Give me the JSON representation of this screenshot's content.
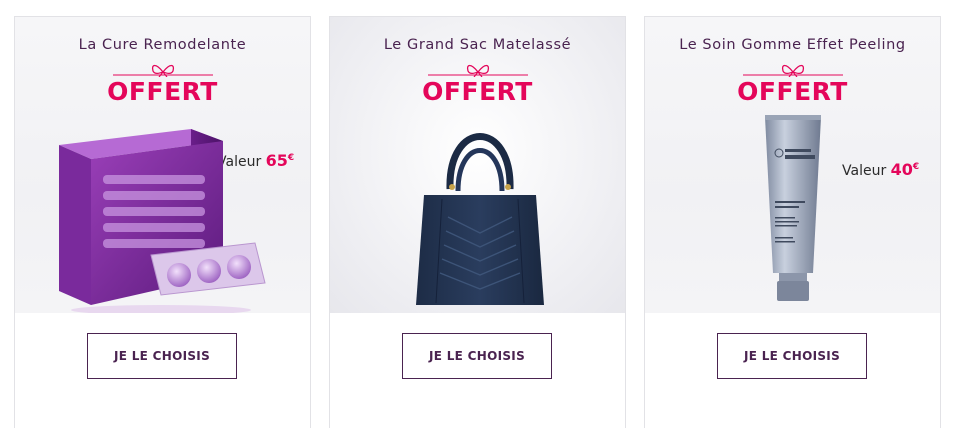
{
  "offers": [
    {
      "title": "La Cure Remodelante",
      "badge": "OFFERT",
      "value_label": "Valeur",
      "value_amount": "65",
      "currency": "€",
      "cta_label": "JE LE CHOISIS",
      "icon": "bow-ribbon-icon"
    },
    {
      "title": "Le Grand Sac Matelassé",
      "badge": "OFFERT",
      "cta_label": "JE LE CHOISIS",
      "icon": "bow-ribbon-icon"
    },
    {
      "title": "Le Soin Gomme Effet Peeling",
      "badge": "OFFERT",
      "value_label": "Valeur",
      "value_amount": "40",
      "currency": "€",
      "cta_label": "JE LE CHOISIS",
      "icon": "bow-ribbon-icon"
    }
  ],
  "colors": {
    "accent": "#e4065a",
    "brand_purple": "#4a2350",
    "border": "#e2e2e6"
  }
}
